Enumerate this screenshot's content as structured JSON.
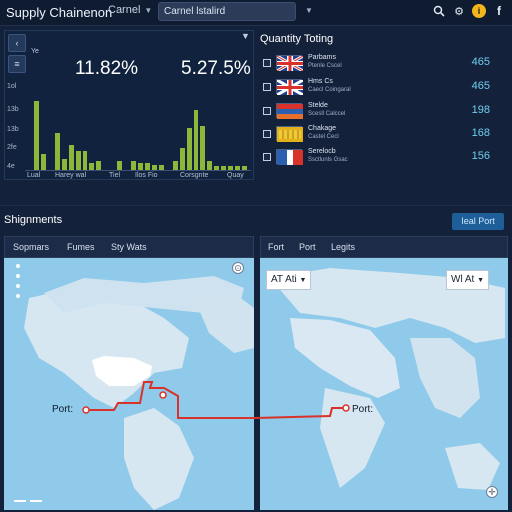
{
  "header": {
    "app_title": "Supply Chainenon",
    "filter_label": "Carnel",
    "search_value": "Carnel lstalird",
    "icons": [
      "search-icon",
      "gear-icon",
      "info-coin-icon",
      "facebook-icon"
    ]
  },
  "kpi": {
    "side_label": "Ye",
    "value_a": "11.82%",
    "value_b": "5.27.5%",
    "y_ticks": [
      "1ol",
      "13b",
      "13b",
      "2fe",
      "4e"
    ],
    "x_labels": [
      "Lual",
      "Harey wal",
      "Tiel",
      "Ilos Fio",
      "Corsgnte",
      "Quay"
    ],
    "bar_values": [
      0,
      0.78,
      0.18,
      0,
      0.42,
      0.12,
      0.28,
      0.22,
      0.22,
      0.08,
      0.1,
      0,
      0,
      0.1,
      0,
      0.1,
      0.08,
      0.08,
      0.06,
      0.06,
      0,
      0.1,
      0.25,
      0.48,
      0.68,
      0.5,
      0.1,
      0.05,
      0.05,
      0.05,
      0.05,
      0.05
    ]
  },
  "quantity": {
    "title": "Quantity Toting",
    "rows": [
      {
        "name": "Parbams",
        "sub": "Ptenle Cscel",
        "value": "465"
      },
      {
        "name": "Hms Cs",
        "sub": "Caecl Coingaral",
        "value": "465"
      },
      {
        "name": "Stelde",
        "sub": "Scesll Calccel",
        "value": "198"
      },
      {
        "name": "Chakage",
        "sub": "Castel Cecl",
        "value": "168"
      },
      {
        "name": "Serelocb",
        "sub": "Ssctlunls Gsac",
        "value": "156"
      }
    ]
  },
  "shipments": {
    "title": "Shignments",
    "button_label": "Ieal Port",
    "left_tabs": [
      "Sopmars",
      "Fumes",
      "Sty Wats"
    ],
    "right_tabs": [
      "Fort",
      "Port",
      "Legits"
    ],
    "left_select": "AT  Ati",
    "right_select": "Wl  At",
    "port_left": "Port:",
    "port_right": "Port:",
    "route_color": "#d8322b"
  }
}
